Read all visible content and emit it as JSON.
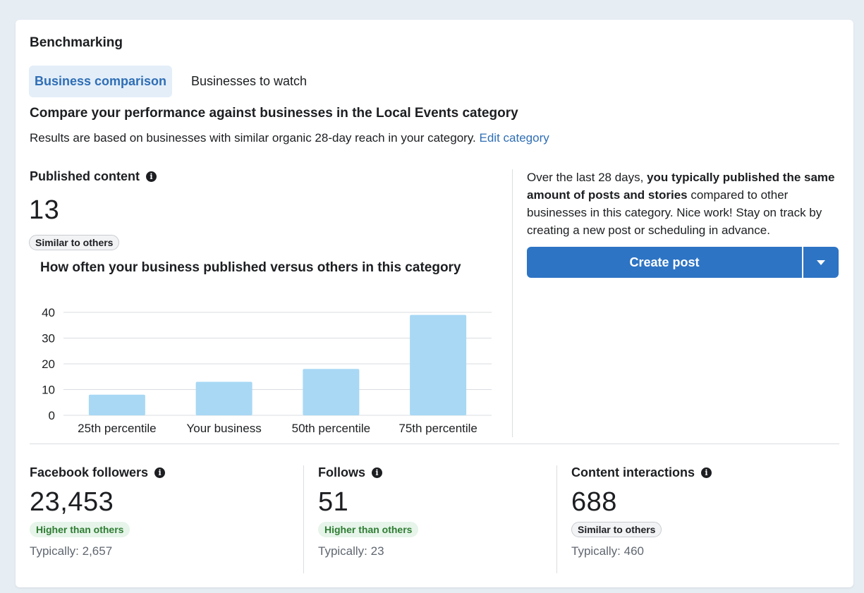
{
  "section_title": "Benchmarking",
  "tabs": [
    {
      "label": "Business comparison",
      "active": true
    },
    {
      "label": "Businesses to watch",
      "active": false
    }
  ],
  "heading": "Compare your performance against businesses in the Local Events category",
  "subtitle": {
    "text": "Results are based on businesses with similar organic 28-day reach in your category.",
    "link": "Edit category"
  },
  "published": {
    "title": "Published content",
    "value": "13",
    "badge": "Similar to others",
    "chart_title": "How often your business published versus others in this category"
  },
  "summary": {
    "prefix": "Over the last 28 days, ",
    "bold": "you typically published the same amount of posts and stories",
    "suffix": " compared to other businesses in this category. Nice work! Stay on track by creating a new post or scheduling in advance."
  },
  "create_post": {
    "label": "Create post"
  },
  "metrics": [
    {
      "title": "Facebook followers",
      "value": "23,453",
      "badge": "Higher than others",
      "badge_type": "higher",
      "typical": "Typically: 2,657"
    },
    {
      "title": "Follows",
      "value": "51",
      "badge": "Higher than others",
      "badge_type": "higher",
      "typical": "Typically: 23"
    },
    {
      "title": "Content interactions",
      "value": "688",
      "badge": "Similar to others",
      "badge_type": "similar",
      "typical": "Typically: 460"
    }
  ],
  "colors": {
    "accent": "#2d74c4",
    "bar": "#a8d8f4",
    "higher": "#2e7d32"
  },
  "chart_data": {
    "type": "bar",
    "title": "How often your business published versus others in this category",
    "categories": [
      "25th percentile",
      "Your business",
      "50th percentile",
      "75th percentile"
    ],
    "values": [
      8,
      13,
      18,
      39
    ],
    "ylim": [
      0,
      40
    ],
    "yticks": [
      0,
      10,
      20,
      30,
      40
    ],
    "grid": true
  }
}
